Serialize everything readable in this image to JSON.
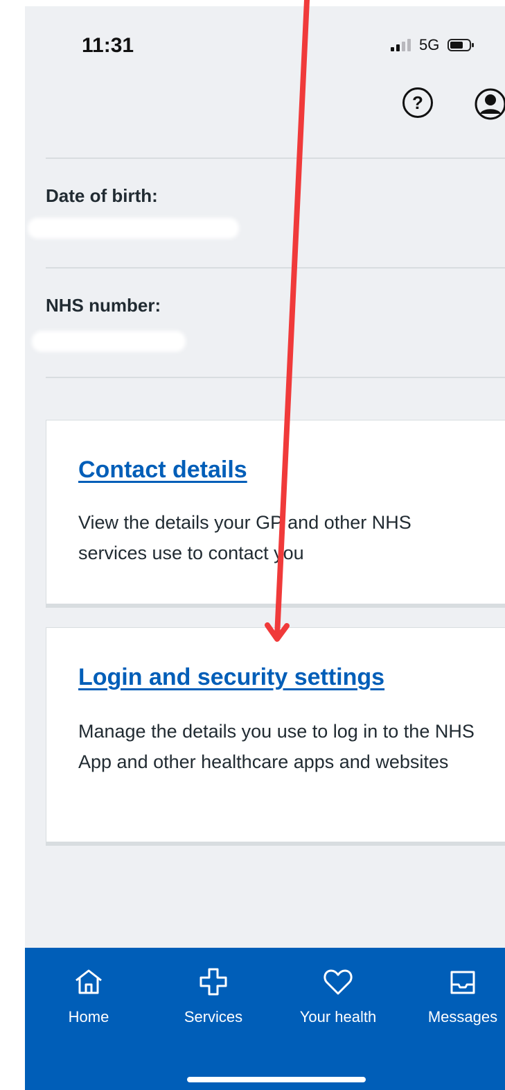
{
  "status_bar": {
    "time": "11:31",
    "network": "5G"
  },
  "header": {
    "help_icon": "help-circle-icon",
    "profile_icon": "user-circle-icon",
    "help_symbol": "?"
  },
  "details": {
    "dob_label": "Date of birth:",
    "nhs_label": "NHS number:"
  },
  "cards": [
    {
      "title": "Contact details",
      "description": "View the details your GP and other NHS services use to contact you"
    },
    {
      "title": "Login and security settings",
      "description": "Manage the details you use to log in to the NHS App and other healthcare apps and websites"
    }
  ],
  "bottom_nav": {
    "items": [
      {
        "label": "Home",
        "icon": "home-icon"
      },
      {
        "label": "Services",
        "icon": "plus-cross-icon"
      },
      {
        "label": "Your health",
        "icon": "heart-icon"
      },
      {
        "label": "Messages",
        "icon": "inbox-icon"
      }
    ]
  },
  "colors": {
    "accent": "#005eb8",
    "background": "#eef0f3",
    "annotation_arrow": "#f03a3a"
  }
}
